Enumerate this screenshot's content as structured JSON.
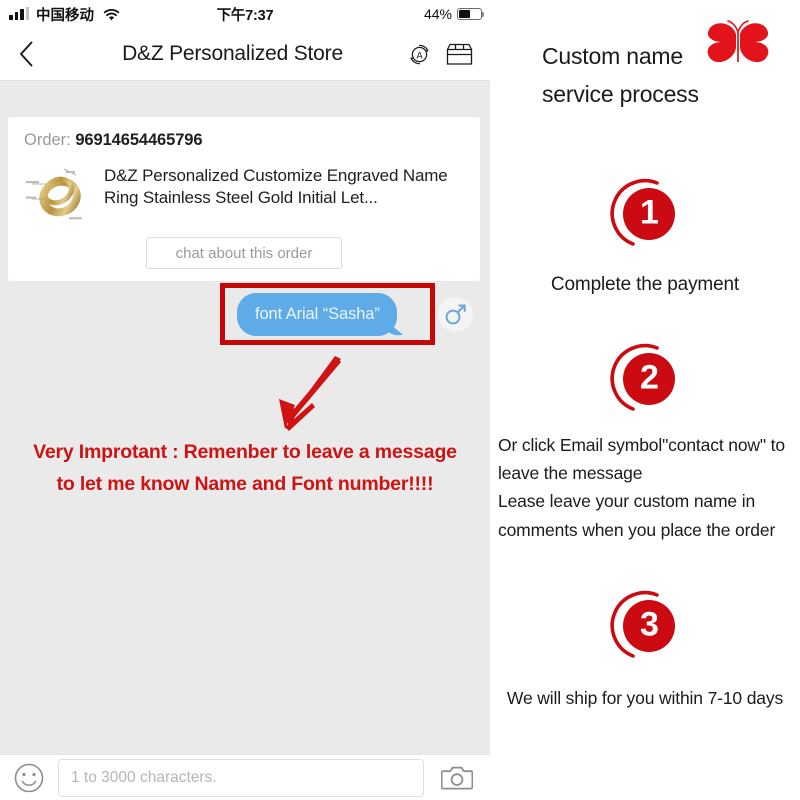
{
  "statusbar": {
    "carrier": "中国移动",
    "time": "下午7:37",
    "battery_percent": "44%",
    "signal_icon": "signal-bars-icon",
    "wifi_icon": "wifi-icon",
    "battery_icon": "battery-icon"
  },
  "navbar": {
    "back_icon": "chevron-left-icon",
    "title": "D&Z Personalized Store",
    "translate_icon": "translate-icon",
    "store_icon": "storefront-icon"
  },
  "order_card": {
    "order_label": "Order:",
    "order_number": "96914654465796",
    "product_thumb_icon": "gold-ring-product-image",
    "product_title": "D&Z Personalized Customize Engraved Name Ring Stainless Steel Gold Initial Let...",
    "chat_button": "chat about this order"
  },
  "message": {
    "bubble_text": "font Arial “Sasha”",
    "avatar_icon": "male-gender-symbol-icon",
    "highlight_color": "#c40707",
    "bubble_color": "#5fabe8"
  },
  "annotation": {
    "arrow_icon": "red-down-left-arrow-icon",
    "warning_line1": "Very Improtant : Remenber to leave a message",
    "warning_line2": "to let me know Name and Font number!!!!",
    "warning_color": "#cf1313"
  },
  "composer": {
    "emoji_icon": "smiley-face-icon",
    "placeholder": "1 to 3000 characters.",
    "value": "",
    "camera_icon": "camera-icon"
  },
  "panel": {
    "heading_line1": "Custom name",
    "heading_line2": "service process",
    "butterfly_icon": "red-butterfly-icon",
    "accent_color": "#cc0a11",
    "steps": [
      {
        "number": "1",
        "badge_icon": "step-badge-1-icon",
        "lines": [
          "Complete the payment"
        ]
      },
      {
        "number": "2",
        "badge_icon": "step-badge-2-icon",
        "lines": [
          "Or click Email symbol\"contact now\" to",
          "leave the message",
          "Lease leave your custom name in",
          "comments when you place the order"
        ]
      },
      {
        "number": "3",
        "badge_icon": "step-badge-3-icon",
        "lines": [
          "We will ship for you within 7-10 days"
        ]
      }
    ]
  }
}
